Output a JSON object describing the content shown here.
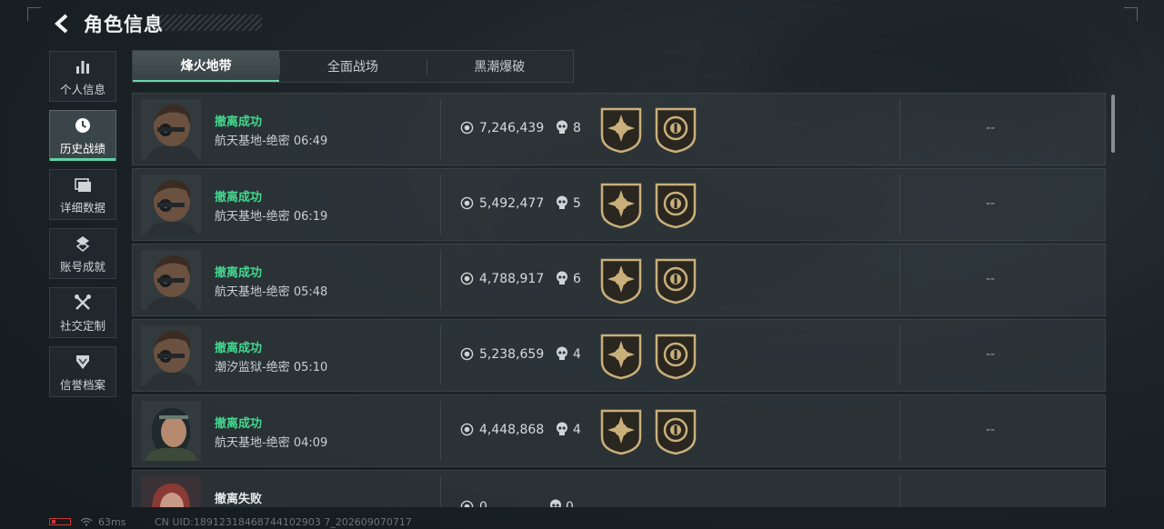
{
  "header": {
    "title": "角色信息"
  },
  "sidebar": {
    "items": [
      {
        "label": "个人信息"
      },
      {
        "label": "历史战绩"
      },
      {
        "label": "详细数据"
      },
      {
        "label": "账号成就"
      },
      {
        "label": "社交定制"
      },
      {
        "label": "信誉档案"
      }
    ]
  },
  "tabs": [
    {
      "label": "烽火地带"
    },
    {
      "label": "全面战场"
    },
    {
      "label": "黑潮爆破"
    }
  ],
  "records": [
    {
      "status": "撤离成功",
      "map": "航天基地-绝密 06:49",
      "value": "7,246,439",
      "kills": "8",
      "extra": "--"
    },
    {
      "status": "撤离成功",
      "map": "航天基地-绝密 06:19",
      "value": "5,492,477",
      "kills": "5",
      "extra": "--"
    },
    {
      "status": "撤离成功",
      "map": "航天基地-绝密 05:48",
      "value": "4,788,917",
      "kills": "6",
      "extra": "--"
    },
    {
      "status": "撤离成功",
      "map": "潮汐监狱-绝密 05:10",
      "value": "5,238,659",
      "kills": "4",
      "extra": "--"
    },
    {
      "status": "撤离成功",
      "map": "航天基地-绝密 04:09",
      "value": "4,448,868",
      "kills": "4",
      "extra": "--"
    },
    {
      "status": "撤离失败",
      "map": "",
      "value": "0",
      "kills": "0",
      "extra": ""
    }
  ],
  "footer": {
    "ping": "63ms",
    "uid": "CN UID:18912318468744102903 7_202609070717"
  },
  "colors": {
    "accent": "#5fd3a4",
    "success": "#43d98e",
    "badge_gold": "#c9b07a"
  }
}
